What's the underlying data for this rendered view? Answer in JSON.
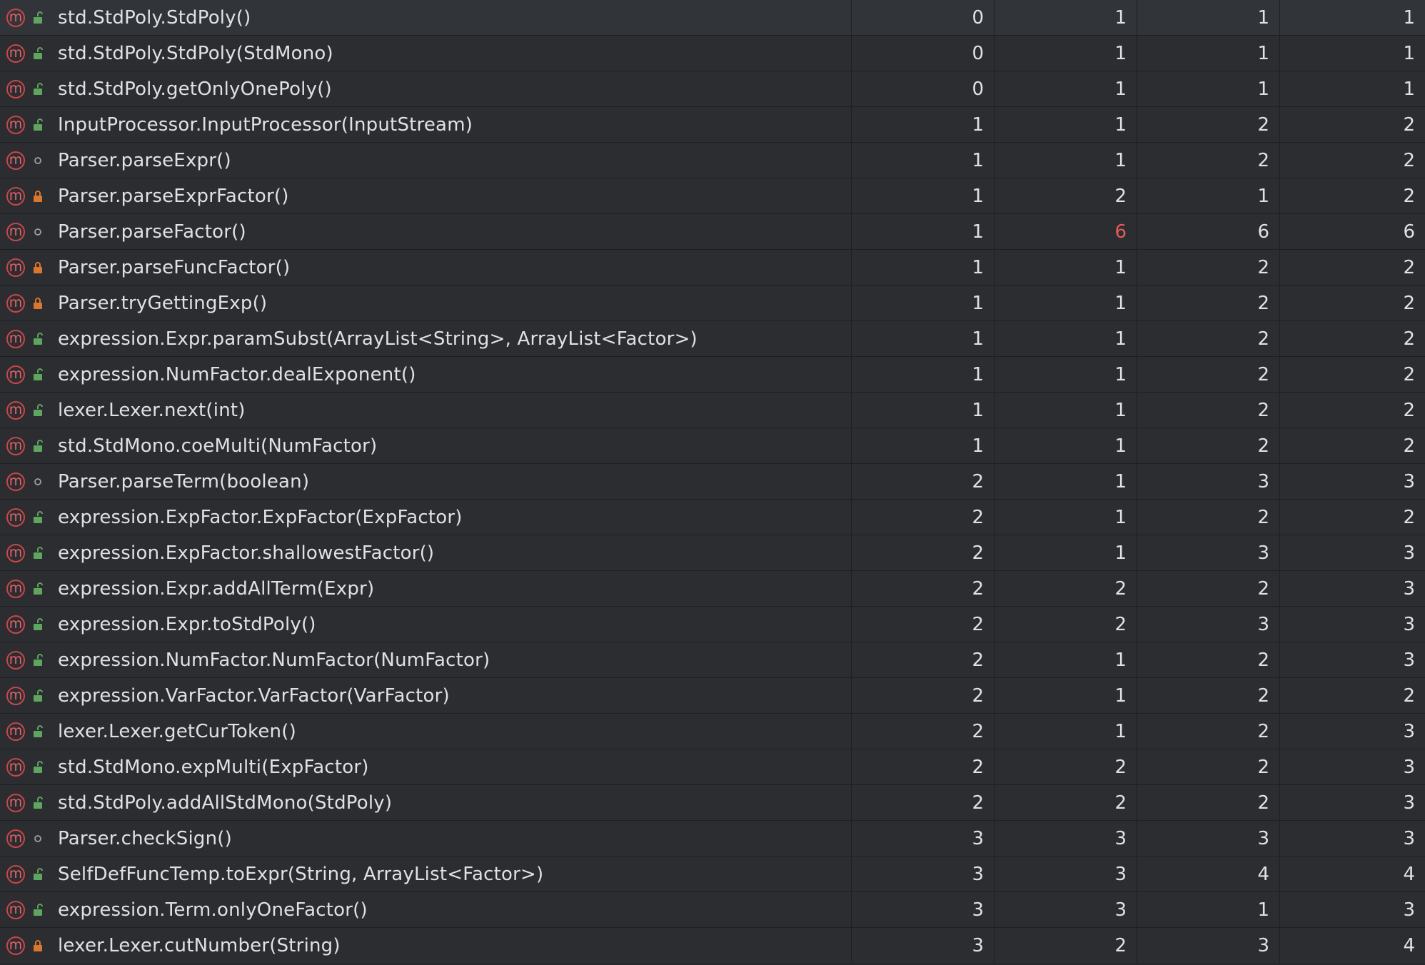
{
  "rows": [
    {
      "method": "std.StdPoly.StdPoly()",
      "visibility": "public",
      "c1": "0",
      "c2": "1",
      "c3": "1",
      "c4": "1"
    },
    {
      "method": "std.StdPoly.StdPoly(StdMono)",
      "visibility": "public",
      "c1": "0",
      "c2": "1",
      "c3": "1",
      "c4": "1"
    },
    {
      "method": "std.StdPoly.getOnlyOnePoly()",
      "visibility": "public",
      "c1": "0",
      "c2": "1",
      "c3": "1",
      "c4": "1"
    },
    {
      "method": "InputProcessor.InputProcessor(InputStream)",
      "visibility": "public",
      "c1": "1",
      "c2": "1",
      "c3": "2",
      "c4": "2"
    },
    {
      "method": "Parser.parseExpr()",
      "visibility": "package",
      "c1": "1",
      "c2": "1",
      "c3": "2",
      "c4": "2"
    },
    {
      "method": "Parser.parseExprFactor()",
      "visibility": "private",
      "c1": "1",
      "c2": "2",
      "c3": "1",
      "c4": "2"
    },
    {
      "method": "Parser.parseFactor()",
      "visibility": "package",
      "c1": "1",
      "c2": "6",
      "c3": "6",
      "c4": "6",
      "highlight_c2": true
    },
    {
      "method": "Parser.parseFuncFactor()",
      "visibility": "private",
      "c1": "1",
      "c2": "1",
      "c3": "2",
      "c4": "2"
    },
    {
      "method": "Parser.tryGettingExp()",
      "visibility": "private",
      "c1": "1",
      "c2": "1",
      "c3": "2",
      "c4": "2"
    },
    {
      "method": "expression.Expr.paramSubst(ArrayList<String>, ArrayList<Factor>)",
      "visibility": "public",
      "c1": "1",
      "c2": "1",
      "c3": "2",
      "c4": "2"
    },
    {
      "method": "expression.NumFactor.dealExponent()",
      "visibility": "public",
      "c1": "1",
      "c2": "1",
      "c3": "2",
      "c4": "2"
    },
    {
      "method": "lexer.Lexer.next(int)",
      "visibility": "public",
      "c1": "1",
      "c2": "1",
      "c3": "2",
      "c4": "2"
    },
    {
      "method": "std.StdMono.coeMulti(NumFactor)",
      "visibility": "public",
      "c1": "1",
      "c2": "1",
      "c3": "2",
      "c4": "2"
    },
    {
      "method": "Parser.parseTerm(boolean)",
      "visibility": "package",
      "c1": "2",
      "c2": "1",
      "c3": "3",
      "c4": "3"
    },
    {
      "method": "expression.ExpFactor.ExpFactor(ExpFactor)",
      "visibility": "public",
      "c1": "2",
      "c2": "1",
      "c3": "2",
      "c4": "2"
    },
    {
      "method": "expression.ExpFactor.shallowestFactor()",
      "visibility": "public",
      "c1": "2",
      "c2": "1",
      "c3": "3",
      "c4": "3"
    },
    {
      "method": "expression.Expr.addAllTerm(Expr)",
      "visibility": "public",
      "c1": "2",
      "c2": "2",
      "c3": "2",
      "c4": "3"
    },
    {
      "method": "expression.Expr.toStdPoly()",
      "visibility": "public",
      "c1": "2",
      "c2": "2",
      "c3": "3",
      "c4": "3"
    },
    {
      "method": "expression.NumFactor.NumFactor(NumFactor)",
      "visibility": "public",
      "c1": "2",
      "c2": "1",
      "c3": "2",
      "c4": "3"
    },
    {
      "method": "expression.VarFactor.VarFactor(VarFactor)",
      "visibility": "public",
      "c1": "2",
      "c2": "1",
      "c3": "2",
      "c4": "2"
    },
    {
      "method": "lexer.Lexer.getCurToken()",
      "visibility": "public",
      "c1": "2",
      "c2": "1",
      "c3": "2",
      "c4": "3"
    },
    {
      "method": "std.StdMono.expMulti(ExpFactor)",
      "visibility": "public",
      "c1": "2",
      "c2": "2",
      "c3": "2",
      "c4": "3"
    },
    {
      "method": "std.StdPoly.addAllStdMono(StdPoly)",
      "visibility": "public",
      "c1": "2",
      "c2": "2",
      "c3": "2",
      "c4": "3"
    },
    {
      "method": "Parser.checkSign()",
      "visibility": "package",
      "c1": "3",
      "c2": "3",
      "c3": "3",
      "c4": "3"
    },
    {
      "method": "SelfDefFuncTemp.toExpr(String, ArrayList<Factor>)",
      "visibility": "public",
      "c1": "3",
      "c2": "3",
      "c3": "4",
      "c4": "4"
    },
    {
      "method": "expression.Term.onlyOneFactor()",
      "visibility": "public",
      "c1": "3",
      "c2": "3",
      "c3": "1",
      "c4": "3"
    },
    {
      "method": "lexer.Lexer.cutNumber(String)",
      "visibility": "private",
      "c1": "3",
      "c2": "2",
      "c3": "3",
      "c4": "4"
    }
  ],
  "icons": {
    "method": "method-icon",
    "public": "public-unlocked-icon",
    "private": "private-lock-icon",
    "package": "package-circle-icon"
  },
  "colors": {
    "background": "#2b2d30",
    "text": "#dfe1e5",
    "highlight": "#e55b5b",
    "method_icon": "#c9464a",
    "public_icon": "#5ea55f",
    "private_icon": "#d9762f",
    "package_icon": "#9da0a8"
  }
}
